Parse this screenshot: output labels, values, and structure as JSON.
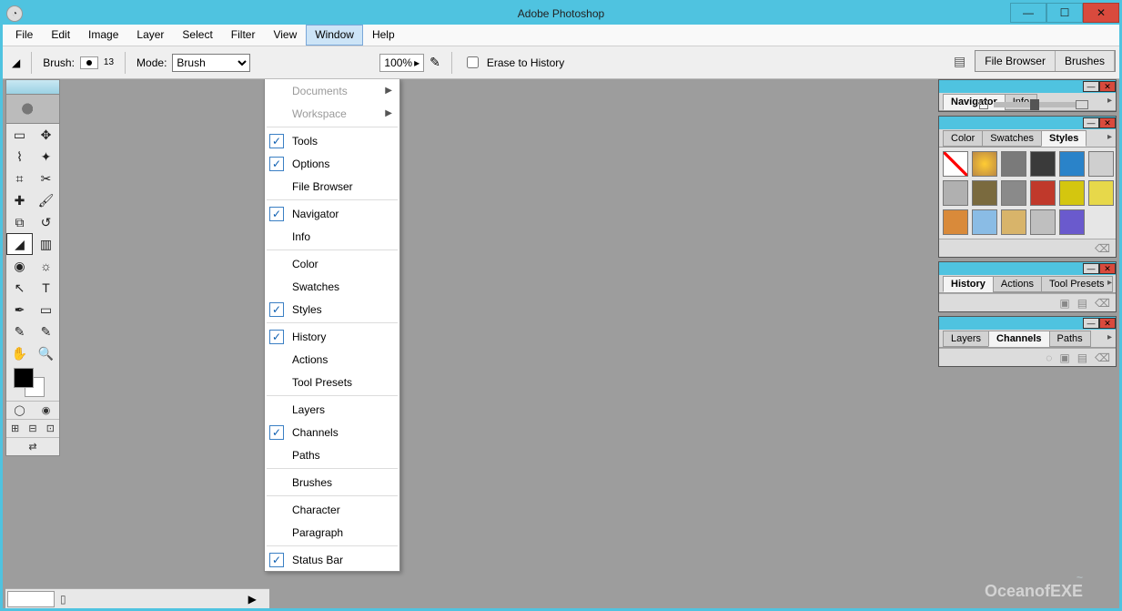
{
  "window": {
    "title": "Adobe Photoshop",
    "controls": {
      "min": "—",
      "max": "☐",
      "close": "✕"
    }
  },
  "menubar": [
    {
      "label": "File"
    },
    {
      "label": "Edit"
    },
    {
      "label": "Image"
    },
    {
      "label": "Layer"
    },
    {
      "label": "Select"
    },
    {
      "label": "Filter"
    },
    {
      "label": "View"
    },
    {
      "label": "Window",
      "active": true
    },
    {
      "label": "Help"
    }
  ],
  "options_bar": {
    "brush_label": "Brush:",
    "brush_size": "13",
    "mode_label": "Mode:",
    "mode_value": "Brush",
    "zoom": "100%",
    "erase_label": "Erase to History",
    "well_tabs": [
      "File Browser",
      "Brushes"
    ]
  },
  "window_menu": [
    {
      "label": "Documents",
      "disabled": true,
      "submenu": true
    },
    {
      "label": "Workspace",
      "disabled": true,
      "submenu": true
    },
    {
      "sep": true
    },
    {
      "label": "Tools",
      "checked": true
    },
    {
      "label": "Options",
      "checked": true
    },
    {
      "label": "File Browser"
    },
    {
      "sep": true
    },
    {
      "label": "Navigator",
      "checked": true
    },
    {
      "label": "Info"
    },
    {
      "sep": true
    },
    {
      "label": "Color"
    },
    {
      "label": "Swatches"
    },
    {
      "label": "Styles",
      "checked": true
    },
    {
      "sep": true
    },
    {
      "label": "History",
      "checked": true
    },
    {
      "label": "Actions"
    },
    {
      "label": "Tool Presets"
    },
    {
      "sep": true
    },
    {
      "label": "Layers"
    },
    {
      "label": "Channels",
      "checked": true
    },
    {
      "label": "Paths"
    },
    {
      "sep": true
    },
    {
      "label": "Brushes"
    },
    {
      "sep": true
    },
    {
      "label": "Character"
    },
    {
      "label": "Paragraph"
    },
    {
      "sep": true
    },
    {
      "label": "Status Bar",
      "checked": true
    }
  ],
  "toolbox": {
    "tools": [
      "marquee",
      "move",
      "lasso",
      "wand",
      "crop",
      "slice",
      "heal",
      "brush",
      "stamp",
      "history-brush",
      "eraser",
      "gradient",
      "blur",
      "dodge",
      "path-select",
      "type",
      "pen",
      "shape",
      "notes",
      "eyedropper",
      "hand",
      "zoom"
    ],
    "selected": "eraser"
  },
  "panels": {
    "navigator": {
      "tabs": [
        "Navigator",
        "Info"
      ],
      "active": "Navigator"
    },
    "color": {
      "tabs": [
        "Color",
        "Swatches",
        "Styles"
      ],
      "active": "Styles",
      "swatches": [
        "none",
        "#ffae00 radial",
        "#7a7a7a",
        "#3a3a3a",
        "#2a83c9",
        "#cfcfcf",
        "#b0b0b0",
        "#7a6a3e",
        "#8a8a8a",
        "#c0392b",
        "#d4c60f",
        "#e7d84a",
        "#d98a3a",
        "#8abce5",
        "#d8b46a",
        "#bfbfbf",
        "#6a5acd"
      ]
    },
    "history": {
      "tabs": [
        "History",
        "Actions",
        "Tool Presets"
      ],
      "active": "History"
    },
    "layers": {
      "tabs": [
        "Layers",
        "Channels",
        "Paths"
      ],
      "active": "Channels"
    }
  },
  "watermark": {
    "line1": "~",
    "line2": "OceanofEXE"
  }
}
